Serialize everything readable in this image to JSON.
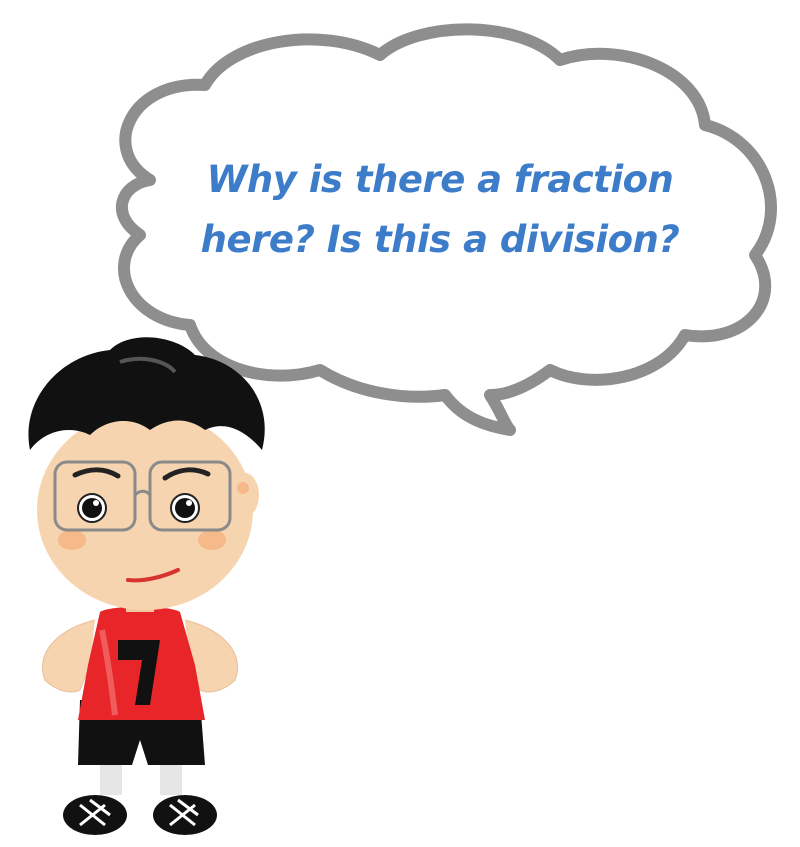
{
  "speech_bubble": {
    "line1": "Why is there a fraction",
    "line2": "here? Is this a division?"
  },
  "character": {
    "shirt_number": "7"
  },
  "colors": {
    "text": "#3d7cc9",
    "bubble_outline": "#8c8c8c",
    "hair": "#111111",
    "skin": "#f7d4b0",
    "shirt": "#e8262a",
    "shorts": "#111111",
    "cheeks": "#f5b98a"
  },
  "icons": [
    "thought-bubble",
    "cartoon-boy"
  ]
}
